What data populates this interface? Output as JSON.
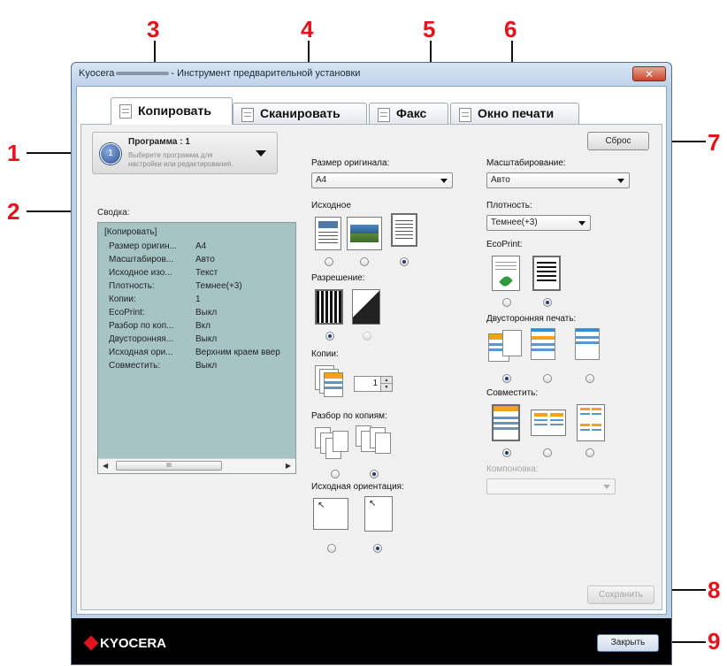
{
  "callouts": [
    "1",
    "2",
    "3",
    "4",
    "5",
    "6",
    "7",
    "8",
    "9"
  ],
  "window": {
    "title_prefix": "Kyocera",
    "title_suffix": "- Инструмент предварительной установки",
    "close_glyph": "✕"
  },
  "tabs": [
    {
      "label": "Копировать",
      "active": true
    },
    {
      "label": "Сканировать",
      "active": false
    },
    {
      "label": "Факс",
      "active": false
    },
    {
      "label": "Окно печати",
      "active": false
    }
  ],
  "program": {
    "number": "1",
    "title": "Программа : 1",
    "hint": "Выберите программа для настройки или редактирования."
  },
  "summary": {
    "label": "Сводка:",
    "title": "[Копировать]",
    "rows": [
      {
        "k": "Размер оригин...",
        "v": "A4"
      },
      {
        "k": "Масштабиров...",
        "v": "Авто"
      },
      {
        "k": "Исходное изо...",
        "v": "Текст"
      },
      {
        "k": "Плотность:",
        "v": "Темнее(+3)"
      },
      {
        "k": "Копии:",
        "v": "1"
      },
      {
        "k": "EcoPrint:",
        "v": "Выкл"
      },
      {
        "k": "Разбор по коп...",
        "v": "Вкл"
      },
      {
        "k": "Двусторонняя...",
        "v": "Выкл"
      },
      {
        "k": "Исходная ори...",
        "v": "Верхним краем ввер"
      },
      {
        "k": "Совместить:",
        "v": "Выкл"
      }
    ],
    "scroll_thumb": "III"
  },
  "middle": {
    "original_size_label": "Размер оригинала:",
    "original_size_value": "A4",
    "original_image_label": "Исходное",
    "resolution_label": "Разрешение:",
    "copies_label": "Копии:",
    "copies_value": "1",
    "collate_label": "Разбор по копиям:",
    "orientation_label": "Исходная ориентация:"
  },
  "right": {
    "reset_label": "Сброс",
    "zoom_label": "Масштабирование:",
    "zoom_value": "Авто",
    "density_label": "Плотность:",
    "density_value": "Темнее(+3)",
    "ecoprint_label": "EcoPrint:",
    "duplex_label": "Двусторонняя печать:",
    "combine_label": "Совместить:",
    "layout_label": "Компоновка:",
    "save_label": "Сохранить"
  },
  "footer": {
    "logo": "KYOCERA",
    "close_label": "Закрыть"
  },
  "colors": {
    "callout": "#e8101b",
    "summary_bg": "#a6c4c4",
    "accent_blue": "#2a8fd6",
    "accent_orange": "#f2a21c"
  }
}
